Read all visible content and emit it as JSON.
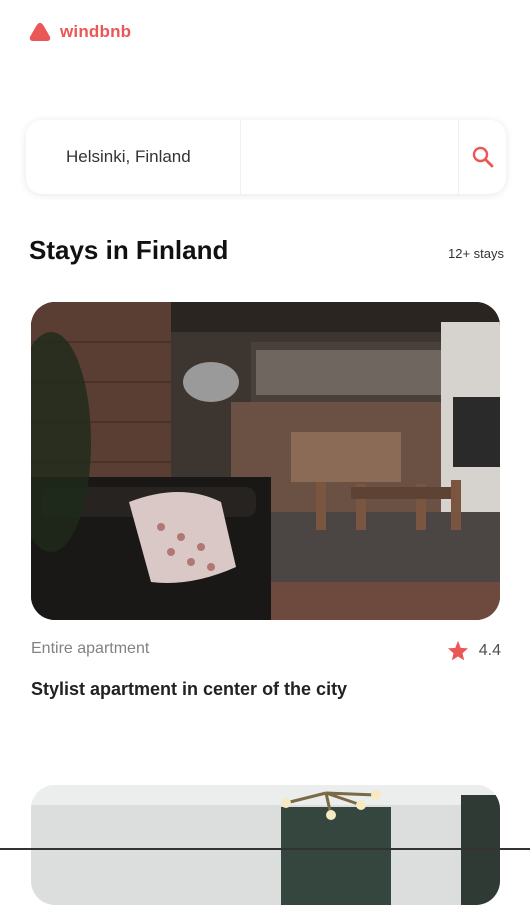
{
  "app": {
    "brand": "windbnb",
    "accent": "#EB5757"
  },
  "search": {
    "location_value": "Helsinki, Finland",
    "guests_value": ""
  },
  "page": {
    "heading": "Stays in Finland",
    "count": "12+ stays"
  },
  "stays": [
    {
      "type": "Entire apartment",
      "rating": "4.4",
      "title": "Stylist apartment in center of the city",
      "image": "loft apartment living room"
    },
    {
      "type": "",
      "rating": "",
      "title": "",
      "image": "interior with ceiling chandelier"
    }
  ],
  "icons": {
    "logo": "logo-icon",
    "search": "search-icon",
    "star": "star-icon"
  }
}
